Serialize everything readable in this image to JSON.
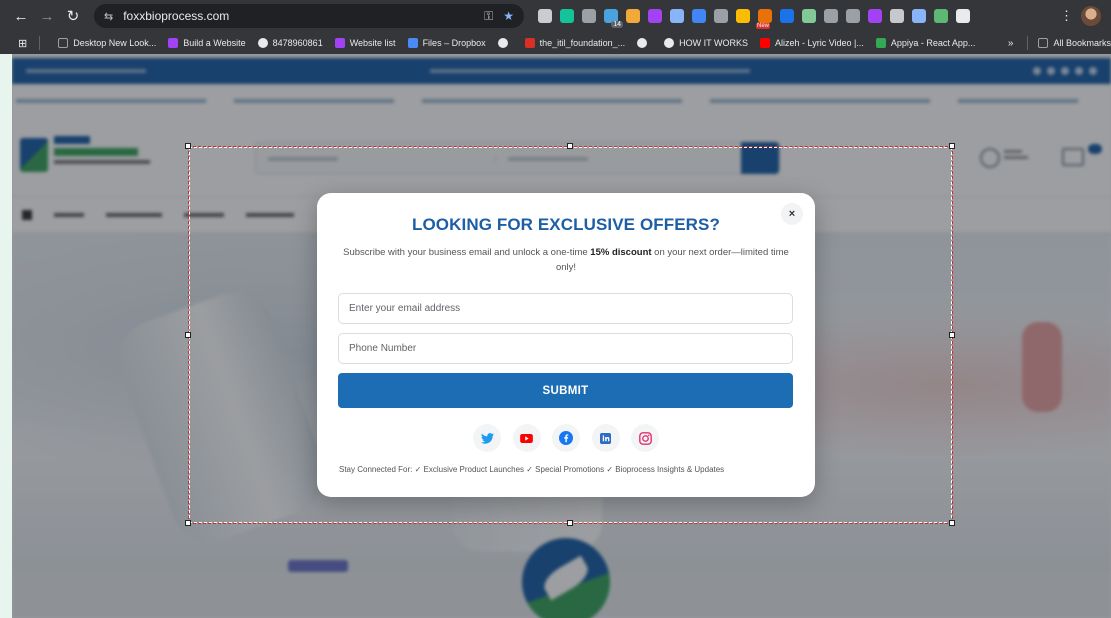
{
  "browser": {
    "url": "foxxbioprocess.com",
    "extensions": [
      {
        "name": "extension-icon",
        "color": "#c9ccd1"
      },
      {
        "name": "grammarly-icon",
        "color": "#15c39a"
      },
      {
        "name": "extension-icon",
        "color": "#9aa0a6"
      },
      {
        "name": "tab-counter-icon",
        "color": "#4aa3df",
        "badge": "14"
      },
      {
        "name": "color-picker-icon",
        "color": "#f2a93b"
      },
      {
        "name": "extension-icon",
        "color": "#a142f4"
      },
      {
        "name": "extension-icon",
        "color": "#8ab4f8"
      },
      {
        "name": "extension-icon",
        "color": "#4285f4"
      },
      {
        "name": "extension-icon",
        "color": "#9aa0a6"
      },
      {
        "name": "extension-icon",
        "color": "#fbbc04"
      },
      {
        "name": "extension-icon",
        "color": "#e8710a",
        "new": "New"
      },
      {
        "name": "extension-icon",
        "color": "#1a73e8"
      },
      {
        "name": "extension-icon",
        "color": "#81c995"
      },
      {
        "name": "extension-icon",
        "color": "#9aa0a6"
      },
      {
        "name": "extension-icon",
        "color": "#9aa0a6"
      },
      {
        "name": "extension-icon",
        "color": "#a142f4"
      },
      {
        "name": "extension-icon",
        "color": "#c5c8cc"
      },
      {
        "name": "extension-icon",
        "color": "#8ab4f8"
      },
      {
        "name": "extension-icon",
        "color": "#5bb974"
      },
      {
        "name": "puzzle-icon",
        "color": "#e8eaed"
      }
    ]
  },
  "bookmarks": {
    "items": [
      {
        "label": "Desktop New Look...",
        "icon": "folder-icon",
        "color": "#9aa0a6"
      },
      {
        "label": "Build a Website",
        "icon": "site-icon",
        "color": "#a142f4"
      },
      {
        "label": "8478960861",
        "icon": "globe-icon",
        "color": "#e8eaed"
      },
      {
        "label": "Website list",
        "icon": "site-icon",
        "color": "#a142f4"
      },
      {
        "label": "Files – Dropbox",
        "icon": "dropbox-icon",
        "color": "#4a8af4"
      },
      {
        "label": "",
        "icon": "globe-icon",
        "color": "#e8eaed"
      },
      {
        "label": "the_itil_foundation_...",
        "icon": "pdf-icon",
        "color": "#d93025"
      },
      {
        "label": "",
        "icon": "globe-icon",
        "color": "#e8eaed"
      },
      {
        "label": "HOW IT WORKS",
        "icon": "globe-icon",
        "color": "#e8eaed"
      },
      {
        "label": "Alizeh - Lyric Video |...",
        "icon": "youtube-icon",
        "color": "#ff0000"
      },
      {
        "label": "Appiya - React App...",
        "icon": "app-icon",
        "color": "#34a853"
      }
    ],
    "more_label": "»",
    "all_bookmarks_label": "All Bookmarks"
  },
  "popup": {
    "title": "LOOKING FOR EXCLUSIVE OFFERS?",
    "desc_before": "Subscribe with your business email and unlock a one-time ",
    "desc_bold": "15% discount",
    "desc_after": " on your next order—limited time only!",
    "email_placeholder": "Enter your email address",
    "phone_placeholder": "Phone Number",
    "submit_label": "SUBMIT",
    "close_label": "×",
    "footer": "Stay Connected For: ✓ Exclusive Product Launches ✓ Special Promotions ✓ Bioprocess Insights & Updates",
    "socials": [
      {
        "name": "twitter",
        "color": "#1d9bf0"
      },
      {
        "name": "youtube",
        "color": "#ff0000"
      },
      {
        "name": "facebook",
        "color": "#1877f2"
      },
      {
        "name": "linkedin",
        "color": "#2b6cc4"
      },
      {
        "name": "instagram",
        "color": "#e1306c"
      }
    ]
  }
}
